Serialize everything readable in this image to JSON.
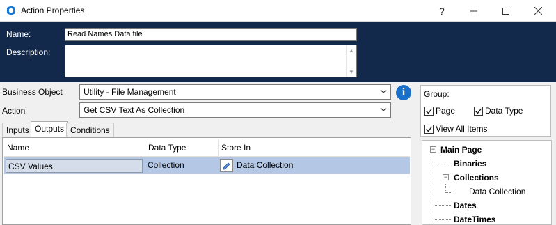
{
  "window": {
    "title": "Action Properties",
    "help_label": "?",
    "app_icon": "blueprism-icon"
  },
  "header": {
    "name_label": "Name:",
    "name_value": "Read Names Data file",
    "description_label": "Description:",
    "description_value": ""
  },
  "form": {
    "business_object_label": "Business Object",
    "business_object_value": "Utility - File Management",
    "action_label": "Action",
    "action_value": "Get CSV Text As Collection"
  },
  "tabs": [
    {
      "label": "Inputs",
      "active": false
    },
    {
      "label": "Outputs",
      "active": true
    },
    {
      "label": "Conditions",
      "active": false
    }
  ],
  "grid": {
    "columns": [
      "Name",
      "Data Type",
      "Store In"
    ],
    "rows": [
      {
        "name": "CSV Values",
        "data_type": "Collection",
        "store_in": "Data Collection",
        "selected": true
      }
    ]
  },
  "group": {
    "label": "Group:",
    "page_label": "Page",
    "page_checked": true,
    "data_type_label": "Data Type",
    "data_type_checked": true,
    "view_all_label": "View All Items",
    "view_all_checked": true
  },
  "tree": {
    "root": "Main Page",
    "items": [
      "Binaries",
      "Collections",
      "Data Collection",
      "Dates",
      "DateTimes"
    ]
  },
  "colors": {
    "header_bg": "#13294b",
    "selected_row": "#b4c8e6",
    "info_blue": "#1a6fc9"
  }
}
